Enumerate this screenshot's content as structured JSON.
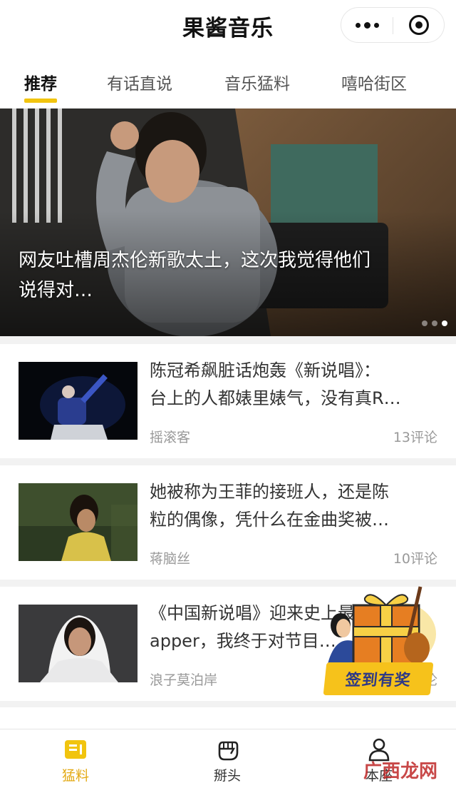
{
  "app": {
    "title": "果酱音乐"
  },
  "tabs": [
    {
      "label": "推荐",
      "active": true
    },
    {
      "label": "有话直说",
      "active": false
    },
    {
      "label": "音乐猛料",
      "active": false
    },
    {
      "label": "嘻哈街区",
      "active": false
    }
  ],
  "banner": {
    "caption_line1": "网友吐槽周杰伦新歌太土，这次我觉得他们",
    "caption_line2": "说得对…",
    "slide_count": 3,
    "active_slide": 3
  },
  "articles": [
    {
      "title_line1": "陈冠希飙脏话炮轰《新说唱》：",
      "title_line2": "台上的人都婊里婊气，没有真R…",
      "author": "摇滚客",
      "comments": "13评论"
    },
    {
      "title_line1": "她被称为王菲的接班人，还是陈",
      "title_line2": "粒的偶像，凭什么在金曲奖被…",
      "author": "蒋脑丝",
      "comments": "10评论"
    },
    {
      "title_line1": "《中国新说唱》迎来史上最美女r",
      "title_line2": "apper，我终于对节目…",
      "author": "浪子莫泊岸",
      "comments": "评论"
    }
  ],
  "promo": {
    "label": "签到有奖"
  },
  "tabbar": {
    "items": [
      {
        "label": "猛料",
        "icon": "news-icon",
        "active": true
      },
      {
        "label": "掰头",
        "icon": "fist-icon",
        "active": false
      },
      {
        "label": "本座",
        "icon": "user-icon",
        "active": false
      }
    ]
  },
  "watermark": "广西龙网",
  "colors": {
    "accent": "#f1c40f",
    "active_tab_label": "#e3aa15",
    "promo_label_bg": "#f6c21b",
    "promo_label_text": "#2f3a85"
  }
}
